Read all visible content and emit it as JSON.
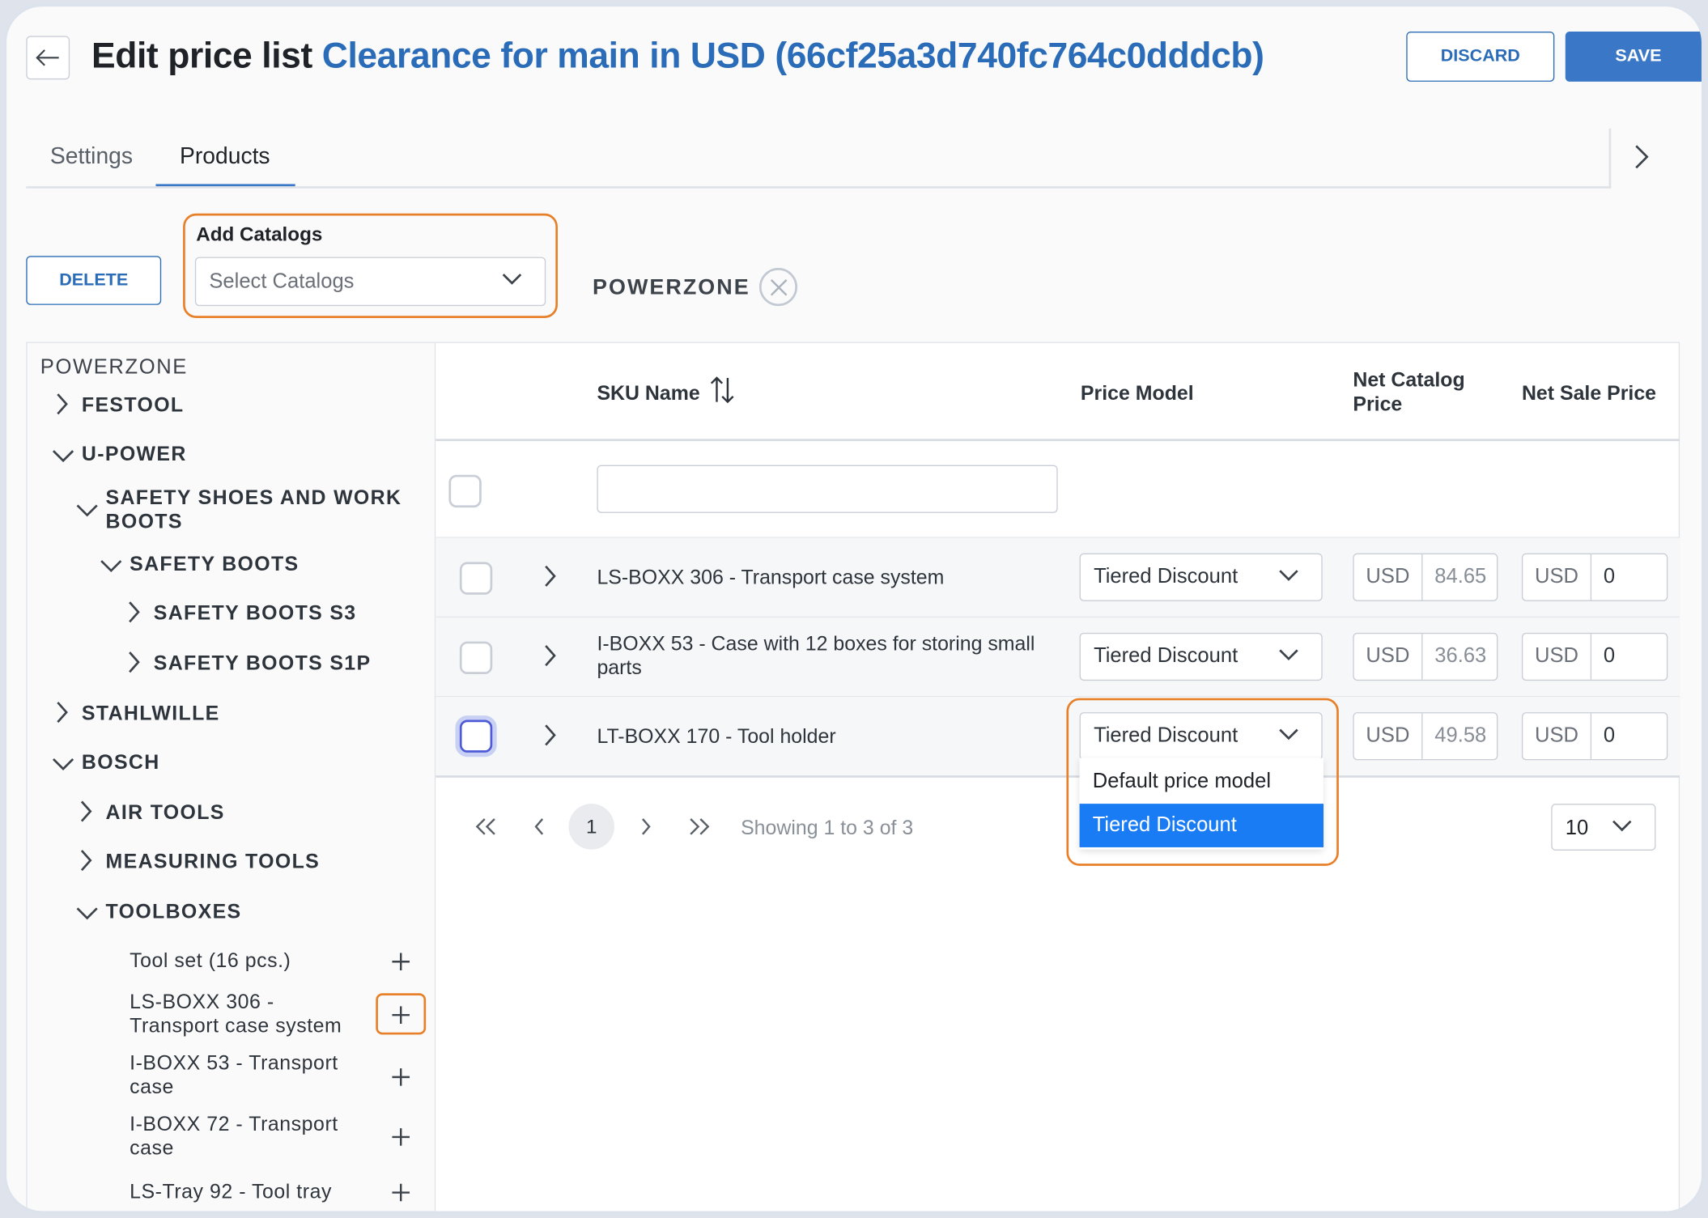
{
  "header": {
    "title_prefix": "Edit price list",
    "title_name": "Clearance for main in USD (66cf25a3d740fc764c0dddcb)",
    "discard_label": "DISCARD",
    "save_label": "SAVE"
  },
  "tabs": [
    {
      "label": "Settings",
      "active": false
    },
    {
      "label": "Products",
      "active": true
    }
  ],
  "toolbar": {
    "delete_label": "DELETE",
    "add_catalogs_label": "Add Catalogs",
    "select_catalogs_placeholder": "Select Catalogs",
    "selected_catalog_chip": "POWERZONE"
  },
  "tree": {
    "root": "POWERZONE",
    "nodes": [
      {
        "label": "FESTOOL",
        "expanded": false
      },
      {
        "label": "U-POWER",
        "expanded": true
      },
      {
        "label": "SAFETY SHOES AND WORK",
        "label2": "BOOTS",
        "expanded": true
      },
      {
        "label": "SAFETY BOOTS",
        "expanded": true
      },
      {
        "label": "SAFETY BOOTS S3",
        "expanded": false
      },
      {
        "label": "SAFETY BOOTS S1P",
        "expanded": false
      },
      {
        "label": "STAHLWILLE",
        "expanded": false
      },
      {
        "label": "BOSCH",
        "expanded": true
      },
      {
        "label": "AIR TOOLS",
        "expanded": false
      },
      {
        "label": "MEASURING TOOLS",
        "expanded": false
      },
      {
        "label": "TOOLBOXES",
        "expanded": true
      }
    ],
    "leaves": [
      {
        "line1": "Tool set (16 pcs.)",
        "line2": ""
      },
      {
        "line1": "LS-BOXX 306 -",
        "line2": "Transport case system"
      },
      {
        "line1": "I-BOXX 53 - Transport",
        "line2": "case"
      },
      {
        "line1": "I-BOXX 72 - Transport",
        "line2": "case"
      },
      {
        "line1": "LS-Tray 92 - Tool tray",
        "line2": ""
      }
    ]
  },
  "table": {
    "columns": {
      "sku": "SKU Name",
      "price_model": "Price Model",
      "net_catalog_1": "Net Catalog",
      "net_catalog_2": "Price",
      "net_sale": "Net Sale Price"
    },
    "rows": [
      {
        "sku_line1": "LS-BOXX 306 - Transport case system",
        "sku_line2": "",
        "price_model": "Tiered Discount",
        "currency": "USD",
        "net_catalog": "84.65",
        "net_sale": "0"
      },
      {
        "sku_line1": "I-BOXX 53 - Case with 12 boxes for storing small",
        "sku_line2": "parts",
        "price_model": "Tiered Discount",
        "currency": "USD",
        "net_catalog": "36.63",
        "net_sale": "0"
      },
      {
        "sku_line1": "LT-BOXX 170 - Tool holder",
        "sku_line2": "",
        "price_model": "Tiered Discount",
        "currency": "USD",
        "net_catalog": "49.58",
        "net_sale": "0"
      }
    ],
    "dropdown_options": [
      "Default price model",
      "Tiered Discount"
    ],
    "dropdown_selected": "Tiered Discount"
  },
  "pagination": {
    "current_page": "1",
    "showing": "Showing 1 to 3 of 3",
    "page_size": "10"
  },
  "colors": {
    "accent": "#3a77c6",
    "highlight": "#e8802a",
    "dropdown_selected": "#1a7cf5"
  }
}
